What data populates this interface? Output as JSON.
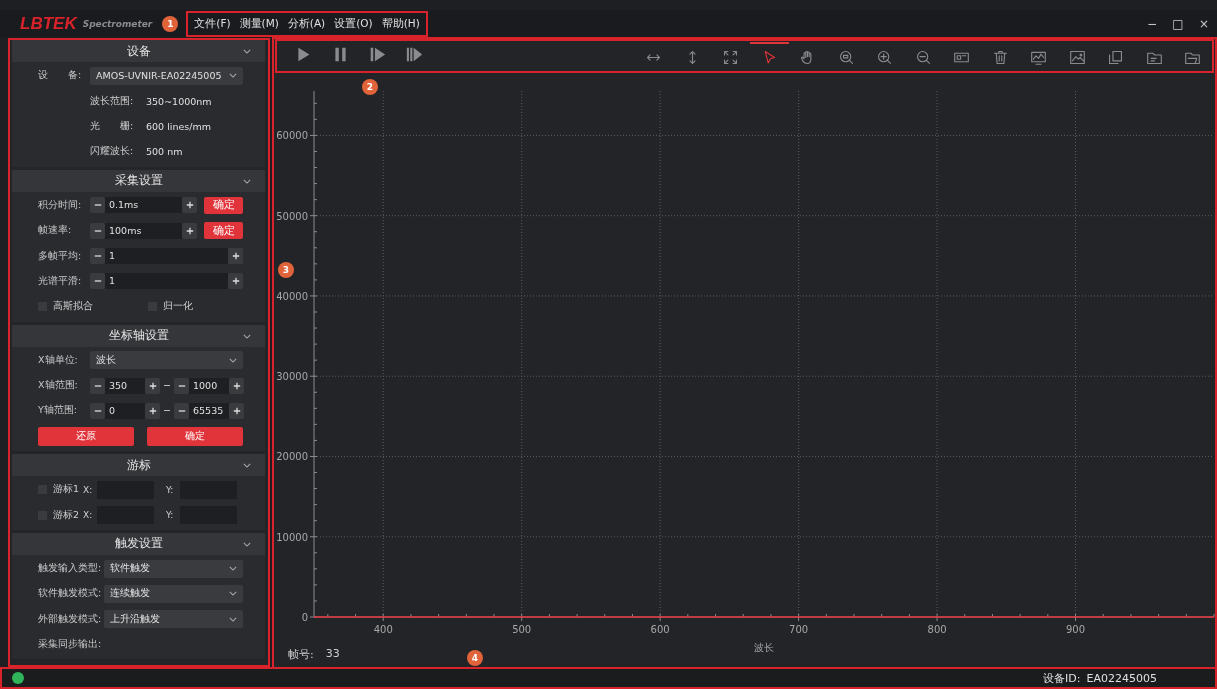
{
  "titlebar": {
    "logo": "LBTEK",
    "product": "Spectrometer",
    "menu": [
      "文件(F)",
      "测量(M)",
      "分析(A)",
      "设置(O)",
      "帮助(H)"
    ],
    "window_controls": [
      "−",
      "□",
      "×"
    ]
  },
  "callouts": [
    "1",
    "2",
    "3",
    "4"
  ],
  "sidebar": {
    "sections": [
      {
        "title": "设备",
        "expanded": true,
        "rows": [
          {
            "kind": "select",
            "label": "设　　备:",
            "value": "AMOS-UVNIR-EA02245005"
          },
          {
            "kind": "info",
            "label": "波长范围:",
            "value": "350~1000nm"
          },
          {
            "kind": "info",
            "label": "光　　栅:",
            "value": "600 lines/mm"
          },
          {
            "kind": "info",
            "label": "闪耀波长:",
            "value": "500 nm"
          }
        ]
      },
      {
        "title": "采集设置",
        "expanded": true,
        "rows": [
          {
            "kind": "spin_confirm",
            "label": "积分时间:",
            "value": "0.1ms",
            "button": "确定"
          },
          {
            "kind": "spin_confirm",
            "label": "帧速率:",
            "value": "100ms",
            "button": "确定"
          },
          {
            "kind": "spin",
            "label": "多帧平均:",
            "value": "1"
          },
          {
            "kind": "spin",
            "label": "光谱平滑:",
            "value": "1"
          },
          {
            "kind": "checks",
            "items": [
              {
                "label": "高斯拟合",
                "checked": false
              },
              {
                "label": "归一化",
                "checked": false
              }
            ]
          }
        ]
      },
      {
        "title": "坐标轴设置",
        "expanded": true,
        "rows": [
          {
            "kind": "select",
            "label": "X轴单位:",
            "value": "波长"
          },
          {
            "kind": "range",
            "label": "X轴范围:",
            "from": "350",
            "to": "1000"
          },
          {
            "kind": "range",
            "label": "Y轴范围:",
            "from": "0",
            "to": "65535"
          },
          {
            "kind": "buttons",
            "items": [
              "还原",
              "确定"
            ]
          }
        ]
      },
      {
        "title": "游标",
        "expanded": true,
        "rows": [
          {
            "kind": "cursor",
            "label": "游标1",
            "checked": false,
            "x_label": "X:",
            "y_label": "Y:"
          },
          {
            "kind": "cursor",
            "label": "游标2",
            "checked": false,
            "x_label": "X:",
            "y_label": "Y:"
          }
        ]
      },
      {
        "title": "触发设置",
        "expanded": true,
        "rows": [
          {
            "kind": "select_wide",
            "label": "触发输入类型:",
            "value": "软件触发"
          },
          {
            "kind": "select_wide",
            "label": "软件触发模式:",
            "value": "连续触发"
          },
          {
            "kind": "select_wide",
            "label": "外部触发模式:",
            "value": "上升沿触发"
          },
          {
            "kind": "label",
            "label": "采集同步输出:"
          }
        ]
      }
    ]
  },
  "toolbar": {
    "tools": [
      {
        "selected": false
      },
      {
        "selected": false
      },
      {
        "selected": false
      },
      {
        "selected": true
      },
      {
        "selected": false
      },
      {
        "selected": false
      },
      {
        "selected": false
      },
      {
        "selected": false
      },
      {
        "selected": false
      },
      {
        "selected": false
      },
      {
        "selected": false
      },
      {
        "selected": false
      },
      {
        "selected": false
      },
      {
        "selected": false
      },
      {
        "selected": false
      }
    ]
  },
  "chart": {
    "chart_data": {
      "type": "line",
      "grid": true,
      "xlabel": "波长",
      "x": [
        350,
        1000
      ],
      "series": [
        {
          "color": "#e0343a",
          "values": [
            0,
            0
          ]
        }
      ],
      "xlim": [
        350,
        1000
      ],
      "ylim": [
        0,
        65535
      ],
      "xticks": [
        400,
        500,
        600,
        700,
        800,
        900
      ],
      "yticks": [
        0,
        10000,
        20000,
        30000,
        40000,
        50000,
        60000
      ]
    }
  },
  "frame": {
    "label": "帧号:",
    "value": "33"
  },
  "status_bar": {
    "label": "设备ID:",
    "value": "EA02245005"
  }
}
